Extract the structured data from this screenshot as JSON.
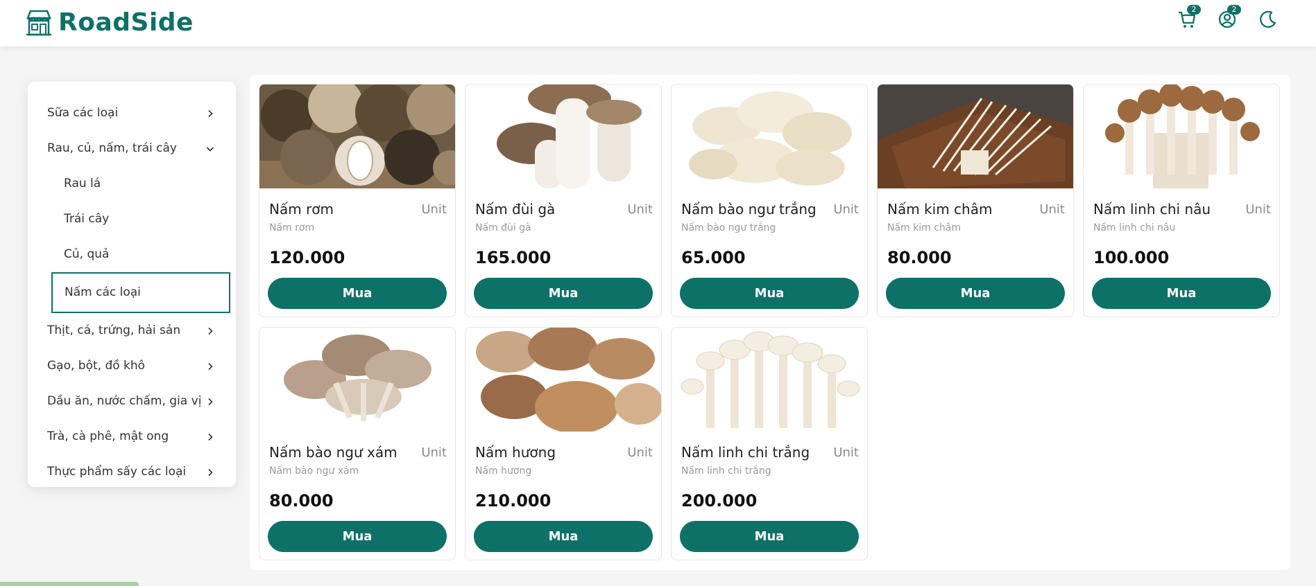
{
  "brand": {
    "name": "RoadSide"
  },
  "header": {
    "cart_icon": "cart-icon",
    "cart_count": "2",
    "user_icon": "user-icon",
    "user_count": "2",
    "theme_icon": "moon-icon",
    "accent": "#0e7168"
  },
  "sidebar": {
    "categories": [
      {
        "label": "Sữa các loại"
      },
      {
        "label": "Rau, củ, nấm, trái cây",
        "expanded": true
      },
      {
        "label": "Rau lá"
      },
      {
        "label": "Trái cây"
      },
      {
        "label": "Củ, quả"
      },
      {
        "label": "Nấm các loại",
        "selected": true
      },
      {
        "label": "Thịt, cá, trứng, hải sản"
      },
      {
        "label": "Gạo, bột, đồ khô"
      },
      {
        "label": "Dầu ăn, nước chấm, gia vị"
      },
      {
        "label": "Trà, cà phê, mật ong"
      },
      {
        "label": "Thực phẩm sấy các loại"
      }
    ]
  },
  "products": [
    {
      "name": "Nấm rơm",
      "unit": "Unit",
      "subtitle": "Nấm rơm",
      "price": "120.000",
      "buy_label": "Mua"
    },
    {
      "name": "Nấm đùi gà",
      "unit": "Unit",
      "subtitle": "Nấm đùi gà",
      "price": "165.000",
      "buy_label": "Mua"
    },
    {
      "name": "Nấm bào ngư trắng",
      "unit": "Unit",
      "subtitle": "Nấm bào ngư trắng",
      "price": "65.000",
      "buy_label": "Mua"
    },
    {
      "name": "Nấm kim châm",
      "unit": "Unit",
      "subtitle": "Nấm kim châm",
      "price": "80.000",
      "buy_label": "Mua"
    },
    {
      "name": "Nấm linh chi nâu",
      "unit": "Unit",
      "subtitle": "Nấm linh chi nâu",
      "price": "100.000",
      "buy_label": "Mua"
    },
    {
      "name": "Nấm bào ngư xám",
      "unit": "Unit",
      "subtitle": "Nấm bào ngư xám",
      "price": "80.000",
      "buy_label": "Mua"
    },
    {
      "name": "Nấm hương",
      "unit": "Unit",
      "subtitle": "Nấm hương",
      "price": "210.000",
      "buy_label": "Mua"
    },
    {
      "name": "Nấm linh chi trắng",
      "unit": "Unit",
      "subtitle": "Nấm linh chi trắng",
      "price": "200.000",
      "buy_label": "Mua"
    }
  ]
}
